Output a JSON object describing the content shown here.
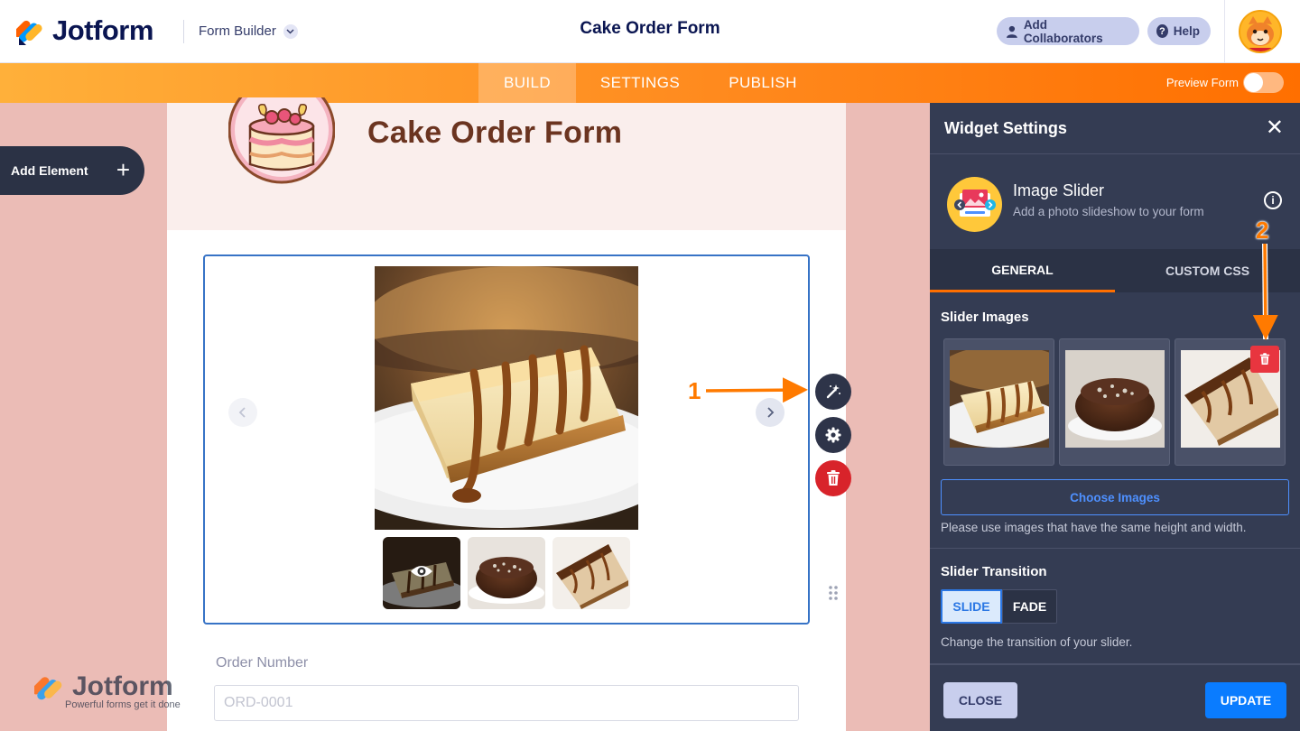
{
  "header": {
    "brand": "Jotform",
    "builder_label": "Form Builder",
    "form_title": "Cake Order Form",
    "collaborators_label": "Add Collaborators",
    "help_label": "Help"
  },
  "nav": {
    "tabs": [
      {
        "label": "BUILD",
        "active": true
      },
      {
        "label": "SETTINGS",
        "active": false
      },
      {
        "label": "PUBLISH",
        "active": false
      }
    ],
    "preview_label": "Preview Form",
    "preview_on": false
  },
  "sidebar": {
    "add_element_label": "Add Element"
  },
  "form": {
    "header_title": "Cake Order Form",
    "fields": {
      "order_number_label": "Order Number",
      "order_number_placeholder": "ORD-0001"
    }
  },
  "annotations": {
    "one": "1",
    "two": "2"
  },
  "watermark": {
    "name": "Jotform",
    "tagline": "Powerful forms get it done"
  },
  "panel": {
    "title": "Widget Settings",
    "widget_name": "Image Slider",
    "widget_desc": "Add a photo slideshow to your form",
    "tabs": [
      {
        "label": "GENERAL",
        "active": true
      },
      {
        "label": "CUSTOM CSS",
        "active": false
      }
    ],
    "slider_images_label": "Slider Images",
    "choose_images_label": "Choose Images",
    "images_hint": "Please use images that have the same height and width.",
    "transition_label": "Slider Transition",
    "transition_options": [
      "SLIDE",
      "FADE"
    ],
    "transition_selected": "SLIDE",
    "transition_hint": "Change the transition of your slider.",
    "close_label": "CLOSE",
    "update_label": "UPDATE"
  },
  "colors": {
    "brand_orange": "#ff6f00",
    "navy": "#0a1551",
    "panel_bg": "#343c53",
    "primary_blue": "#0a7cff",
    "danger": "#e8353f",
    "page_bg": "#ebbcb6"
  }
}
